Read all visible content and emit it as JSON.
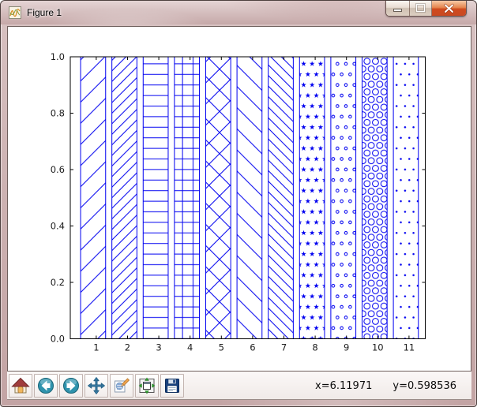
{
  "window": {
    "title": "Figure 1",
    "icon": "matplotlib-logo-icon"
  },
  "titlebar": {
    "buttons": [
      {
        "name": "minimize"
      },
      {
        "name": "maximize"
      },
      {
        "name": "close"
      }
    ]
  },
  "toolbar": {
    "buttons": [
      {
        "name": "home",
        "icon": "home-icon"
      },
      {
        "name": "back",
        "icon": "back-arrow-icon"
      },
      {
        "name": "forward",
        "icon": "forward-arrow-icon"
      },
      {
        "name": "pan",
        "icon": "pan-arrows-icon"
      },
      {
        "name": "zoom-to-rect",
        "icon": "zoom-rect-icon"
      },
      {
        "name": "configure-subplots",
        "icon": "subplots-icon"
      },
      {
        "name": "save",
        "icon": "save-floppy-icon"
      }
    ],
    "status_x": "x=6.11971",
    "status_y": "y=0.598536"
  },
  "chart_data": {
    "type": "bar",
    "title": "",
    "xlabel": "",
    "ylabel": "",
    "grid": false,
    "categories": [
      1,
      2,
      3,
      4,
      5,
      6,
      7,
      8,
      9,
      10,
      11
    ],
    "values": [
      1.0,
      1.0,
      1.0,
      1.0,
      1.0,
      1.0,
      1.0,
      1.0,
      1.0,
      1.0,
      1.0
    ],
    "hatches": [
      "/",
      "//",
      "-",
      "+",
      "x",
      "\\",
      "\\\\",
      "*",
      "o",
      "O",
      "."
    ],
    "bar_width": 0.8,
    "bar_left_offset": -0.5,
    "xtick_labels": [
      "1",
      "2",
      "3",
      "4",
      "5",
      "6",
      "7",
      "8",
      "9",
      "10",
      "11"
    ],
    "ytick_labels": [
      "0.0",
      "0.2",
      "0.4",
      "0.6",
      "0.8",
      "1.0"
    ],
    "ytick_values": [
      0,
      0.2,
      0.4,
      0.6,
      0.8,
      1.0
    ],
    "xlim": [
      0.17,
      11.52
    ],
    "ylim": [
      0,
      1
    ],
    "bar_fill": "#ffffff",
    "edge_color": "#0000f0",
    "hatch_color": "#0000f0",
    "spine_color": "#000000",
    "tick_label_color": "#1c1c1c"
  }
}
